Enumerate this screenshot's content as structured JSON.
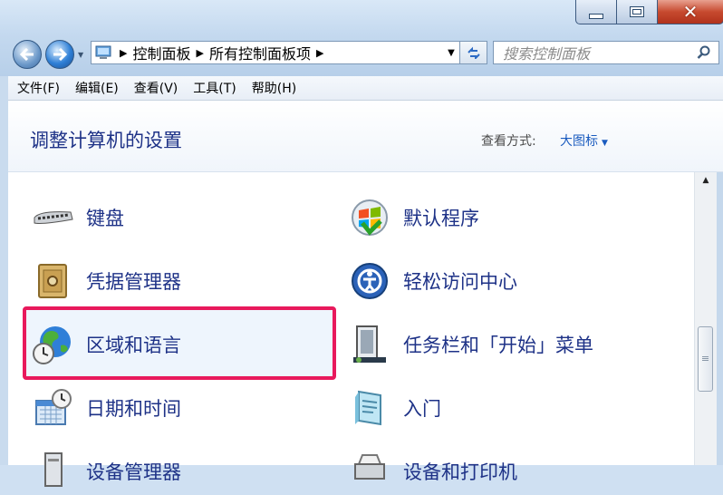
{
  "window": {
    "controls": {
      "minimize": "minimize",
      "maximize": "maximize",
      "close": "close"
    }
  },
  "nav": {
    "breadcrumb": [
      "控制面板",
      "所有控制面板项"
    ],
    "search_placeholder": "搜索控制面板"
  },
  "menu": [
    "文件(F)",
    "编辑(E)",
    "查看(V)",
    "工具(T)",
    "帮助(H)"
  ],
  "header": {
    "title": "调整计算机的设置",
    "view_label": "查看方式:",
    "view_value": "大图标"
  },
  "items": [
    {
      "label": "键盘",
      "icon": "keyboard-icon"
    },
    {
      "label": "默认程序",
      "icon": "default-programs-icon"
    },
    {
      "label": "凭据管理器",
      "icon": "credential-manager-icon"
    },
    {
      "label": "轻松访问中心",
      "icon": "ease-of-access-icon"
    },
    {
      "label": "区域和语言",
      "icon": "region-language-icon"
    },
    {
      "label": "任务栏和「开始」菜单",
      "icon": "taskbar-start-menu-icon"
    },
    {
      "label": "日期和时间",
      "icon": "date-time-icon"
    },
    {
      "label": "入门",
      "icon": "getting-started-icon"
    },
    {
      "label": "设备管理器",
      "icon": "device-manager-icon"
    },
    {
      "label": "设备和打印机",
      "icon": "devices-printers-icon"
    }
  ],
  "colors": {
    "link_blue": "#1e3287",
    "highlight_border": "#e8195c"
  }
}
